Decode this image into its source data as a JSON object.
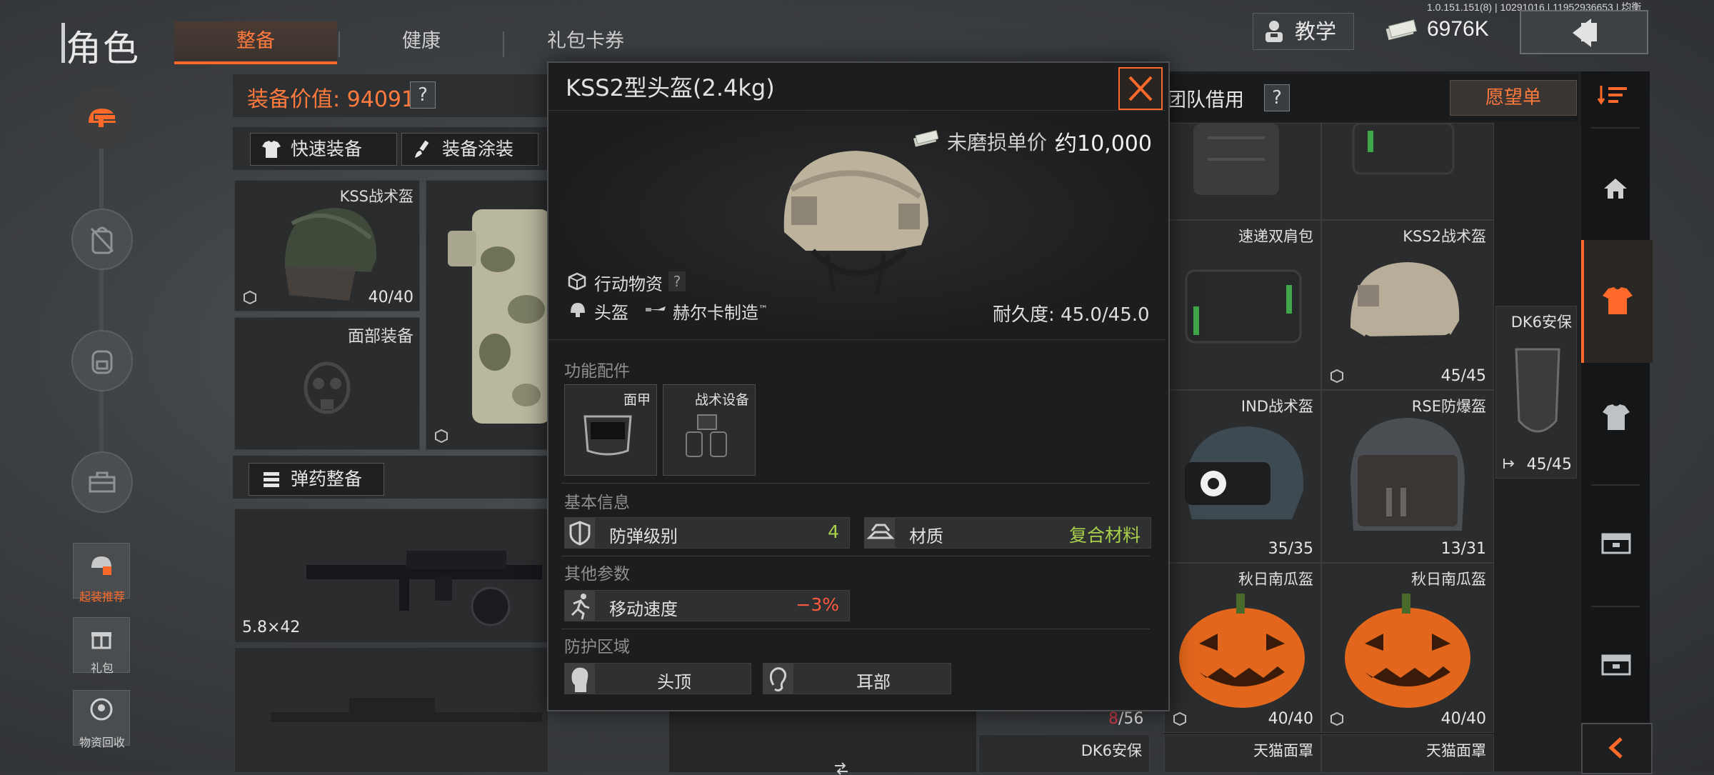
{
  "app": {
    "title": "角色",
    "tabs": [
      {
        "label": "整备",
        "active": true
      },
      {
        "label": "健康",
        "active": false
      },
      {
        "label": "礼包卡券",
        "active": false
      }
    ],
    "teach_label": "教学",
    "version": "1.0.151.151(8) | 10291016 | 11952936653 | 均衡",
    "money": "6976K"
  },
  "sidebar": {
    "buttons": [
      {
        "label": "起装推荐",
        "highlight": true
      },
      {
        "label": "礼包",
        "highlight": false
      },
      {
        "label": "物资回收",
        "highlight": false
      }
    ]
  },
  "equipment": {
    "value_label": "装备价值: 94091",
    "help": "?",
    "quick_equip": "快速装备",
    "paint": "装备涂装",
    "helmet_slot": {
      "name": "KSS战术盔",
      "count": "40/40"
    },
    "face_slot": {
      "name": "面部装备"
    },
    "ammo_label": "弹药整备",
    "weapon_caliber": "5.8×42"
  },
  "inventory": {
    "header": "团队借用",
    "help": "?",
    "wishlist": "愿望单",
    "cells": [
      {
        "name": "速递双肩包",
        "count": ""
      },
      {
        "name": "KSS2战术盔",
        "count": "45/45"
      },
      {
        "name": "IND战术盔",
        "count": "35/35"
      },
      {
        "name": "RSE防爆盔",
        "count": "13/31"
      },
      {
        "name": "秋日南瓜盔",
        "count": "40/40"
      },
      {
        "name": "秋日南瓜盔",
        "count": "40/40"
      },
      {
        "name": "DK6安保",
        "count": "45/45"
      },
      {
        "name": "DK6安保",
        "count": ""
      },
      {
        "name": "天猫面罩",
        "count": ""
      },
      {
        "name": "天猫面罩",
        "count": ""
      }
    ],
    "capacity_used": "8",
    "capacity_total": "/56"
  },
  "modal": {
    "title": "KSS2型头盔(2.4kg)",
    "price_label": "未磨损单价 :",
    "price_value": "约10,000",
    "category": "行动物资",
    "category_help": "?",
    "type": "头盔",
    "maker": "赫尔卡制造",
    "maker_tm": "™",
    "durability": "耐久度:  45.0/45.0",
    "sections": {
      "accessories": "功能配件",
      "basic_info": "基本信息",
      "other_params": "其他参数",
      "protection_area": "防护区域"
    },
    "accessories": [
      {
        "label": "面甲"
      },
      {
        "label": "战术设备"
      }
    ],
    "stats": {
      "armor_level": {
        "name": "防弹级别",
        "value": "4"
      },
      "material": {
        "name": "材质",
        "value": "复合材料"
      },
      "move_speed": {
        "name": "移动速度",
        "value": "−3%"
      }
    },
    "protection": [
      {
        "label": "头顶"
      },
      {
        "label": "耳部"
      }
    ]
  },
  "colors": {
    "accent": "#ff6a2a",
    "positive": "#a8d04a",
    "negative": "#ff5a3c"
  }
}
